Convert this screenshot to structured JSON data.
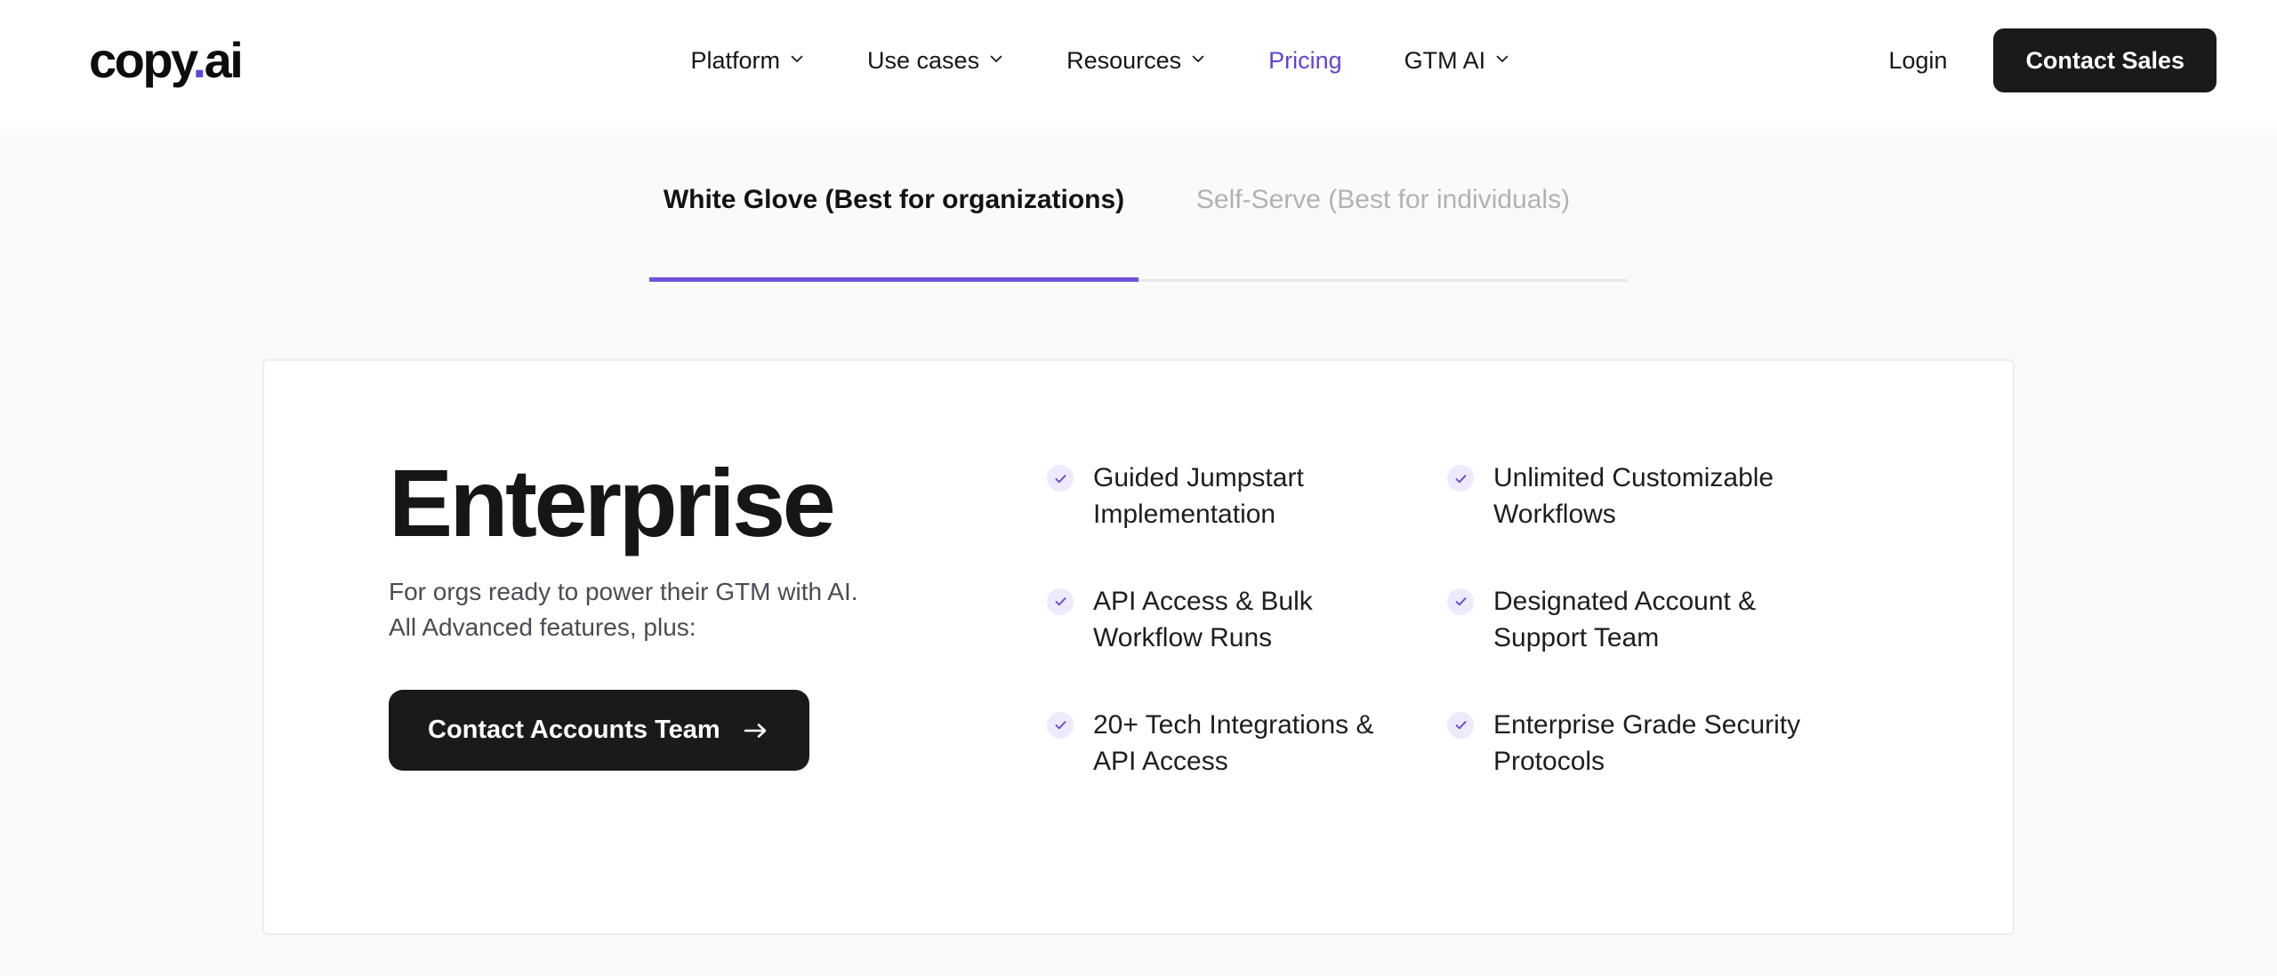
{
  "brand": {
    "name_part1": "copy",
    "dot": ".",
    "name_part2": "ai",
    "accent_color": "#5f45d9"
  },
  "header": {
    "nav": [
      {
        "label": "Platform",
        "has_chevron": true,
        "icon": "chevron-down-icon",
        "accent": false
      },
      {
        "label": "Use cases",
        "has_chevron": true,
        "icon": "chevron-down-icon",
        "accent": false
      },
      {
        "label": "Resources",
        "has_chevron": true,
        "icon": "chevron-down-icon",
        "accent": false
      },
      {
        "label": "Pricing",
        "has_chevron": false,
        "icon": "",
        "accent": true
      },
      {
        "label": "GTM AI",
        "has_chevron": true,
        "icon": "chevron-down-icon",
        "accent": false
      }
    ],
    "login_label": "Login",
    "contact_sales_label": "Contact Sales",
    "contact_sales_bg": "#1a1a1a"
  },
  "tabs": [
    {
      "label": "White Glove (Best for organizations)",
      "active": true,
      "underline_color": "#7051d8"
    },
    {
      "label": "Self-Serve (Best for individuals)",
      "active": false,
      "underline_color": "#e8e8e8"
    }
  ],
  "plan": {
    "title": "Enterprise",
    "subtitle_line1": "For orgs ready to power their GTM with AI.",
    "subtitle_line2": "All Advanced features, plus:",
    "cta_label": "Contact Accounts Team",
    "cta_icon": "arrow-right-icon",
    "cta_bg": "#1a1a1a",
    "features_column_1": [
      "Guided Jumpstart Implementation",
      "API Access & Bulk Workflow Runs",
      "20+ Tech Integrations & API Access"
    ],
    "features_column_2": [
      "Unlimited Customizable Workflows",
      "Designated Account & Support Team",
      "Enterprise Grade Security Protocols"
    ],
    "check_icon": "check-icon",
    "check_bg": "#eeeafc",
    "check_color": "#6b4ccf"
  }
}
